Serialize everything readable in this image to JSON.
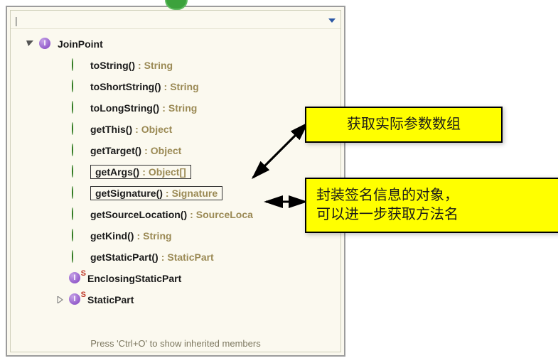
{
  "root": {
    "name": "JoinPoint",
    "children": [
      {
        "name": "toString()",
        "returnType": "String"
      },
      {
        "name": "toShortString()",
        "returnType": "String"
      },
      {
        "name": "toLongString()",
        "returnType": "String"
      },
      {
        "name": "getThis()",
        "returnType": "Object"
      },
      {
        "name": "getTarget()",
        "returnType": "Object"
      },
      {
        "name": "getArgs()",
        "returnType": "Object[]",
        "highlighted": true
      },
      {
        "name": "getSignature()",
        "returnType": "Signature",
        "highlighted": true
      },
      {
        "name": "getSourceLocation()",
        "returnType": "SourceLoca"
      },
      {
        "name": "getKind()",
        "returnType": "String"
      },
      {
        "name": "getStaticPart()",
        "returnType": "StaticPart"
      }
    ],
    "subtypes": [
      {
        "name": "EnclosingStaticPart",
        "expanded": false,
        "static": true
      },
      {
        "name": "StaticPart",
        "expanded": false,
        "static": true,
        "hasChildren": true
      }
    ]
  },
  "filterCursor": "|",
  "footer": "Press 'Ctrl+O' to show inherited members",
  "callouts": {
    "args": "获取实际参数数组",
    "signature": "封装签名信息的对象，\n可以进一步获取方法名"
  }
}
